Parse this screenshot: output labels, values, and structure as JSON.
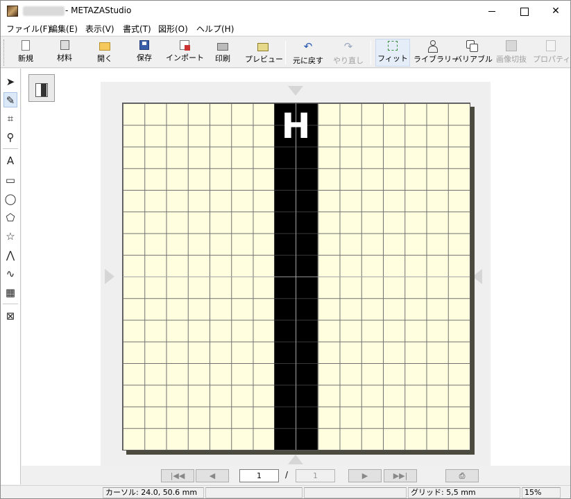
{
  "window": {
    "title": "- METAZAStudio",
    "minimize": "",
    "maximize": "",
    "close": "✕"
  },
  "menu": [
    "ファイル(F)",
    "編集(E)",
    "表示(V)",
    "書式(T)",
    "図形(O)",
    "ヘルプ(H)"
  ],
  "toolbar": {
    "new": "新規",
    "material": "材料",
    "open": "開く",
    "save": "保存",
    "import": "インポート",
    "print": "印刷",
    "preview": "プレビュー",
    "undo": "元に戻す",
    "redo": "やり直し",
    "fit": "フィット",
    "library": "ライブラリー",
    "variable": "バリアブル",
    "image_switch": "画像切抜",
    "properties": "プロパティ",
    "undo_glyph": "↶",
    "redo_glyph": "↷"
  },
  "tools": {
    "select": "➤",
    "node": "✎",
    "crop": "⌗",
    "zoom": "⚲",
    "text": "A",
    "rect": "▭",
    "ellipse": "◯",
    "polygon": "⬠",
    "star": "☆",
    "polyline": "⋀",
    "curve": "∿",
    "image": "▦",
    "frame": "⊠"
  },
  "canvas": {
    "letter": "H",
    "paper_color": "#ffffe0",
    "strip_color": "#000000"
  },
  "pagenav": {
    "first": "|◀◀",
    "prev": "◀",
    "current_page": "1",
    "separator": "/",
    "total_pages": "1",
    "next": "▶",
    "last": "▶▶|",
    "output": "⎙"
  },
  "status": {
    "cursor": "カーソル: 24.0, 50.6 mm",
    "pane2": "",
    "pane3": "",
    "grid": "グリッド: 5,5 mm",
    "zoom": "15%"
  }
}
